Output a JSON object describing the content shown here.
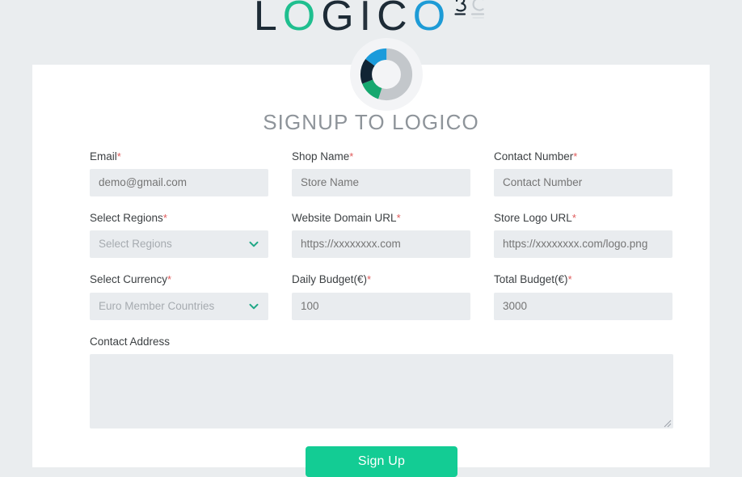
{
  "brand": {
    "wordmark_part1": "L",
    "wordmark_o1": "O",
    "wordmark_g": "G",
    "wordmark_i": "I",
    "wordmark_c": "C",
    "wordmark_o2": "O",
    "wordmark_full": "LOGICO",
    "badge_text": "3C",
    "colors": {
      "dark": "#1d2b36",
      "green": "#1fbf8f",
      "blue": "#1d9bd6"
    }
  },
  "avatar": {
    "icon": "donut-chart-icon",
    "segments": [
      {
        "name": "gray",
        "color": "#c3c7cb",
        "value": 55
      },
      {
        "name": "green",
        "color": "#16a86f",
        "value": 14
      },
      {
        "name": "navy",
        "color": "#112434",
        "value": 16
      },
      {
        "name": "blue",
        "color": "#1b9bdb",
        "value": 15
      }
    ]
  },
  "page": {
    "title": "SIGNUP TO LOGICO",
    "background": "#eaedef",
    "card_background": "#ffffff"
  },
  "form": {
    "required_marker": "*",
    "rows": [
      [
        {
          "name": "email",
          "label": "Email",
          "required": true,
          "type": "text",
          "value": "",
          "placeholder": "demo@gmail.com"
        },
        {
          "name": "shop-name",
          "label": "Shop Name",
          "required": true,
          "type": "text",
          "value": "",
          "placeholder": "Store Name"
        },
        {
          "name": "contact-number",
          "label": "Contact Number",
          "required": true,
          "type": "text",
          "value": "",
          "placeholder": "Contact Number"
        }
      ],
      [
        {
          "name": "select-regions",
          "label": "Select Regions",
          "required": true,
          "type": "select",
          "value": "Select Regions",
          "placeholder": "Select Regions"
        },
        {
          "name": "website-domain-url",
          "label": "Website Domain URL",
          "required": true,
          "type": "text",
          "value": "",
          "placeholder": "https://xxxxxxxx.com"
        },
        {
          "name": "store-logo-url",
          "label": "Store Logo URL",
          "required": true,
          "type": "text",
          "value": "",
          "placeholder": "https://xxxxxxxx.com/logo.png"
        }
      ],
      [
        {
          "name": "select-currency",
          "label": "Select Currency",
          "required": true,
          "type": "select",
          "value": "Euro Member Countries",
          "placeholder": "Euro Member Countries"
        },
        {
          "name": "daily-budget",
          "label": "Daily Budget(€)",
          "required": true,
          "type": "text",
          "value": "",
          "placeholder": "100"
        },
        {
          "name": "total-budget",
          "label": "Total Budget(€)",
          "required": true,
          "type": "text",
          "value": "",
          "placeholder": "3000"
        }
      ]
    ],
    "contact_address": {
      "name": "contact-address",
      "label": "Contact Address",
      "required": false,
      "type": "textarea",
      "value": "",
      "placeholder": ""
    },
    "submit": {
      "label": "Sign Up",
      "color": "#13cc94"
    }
  }
}
